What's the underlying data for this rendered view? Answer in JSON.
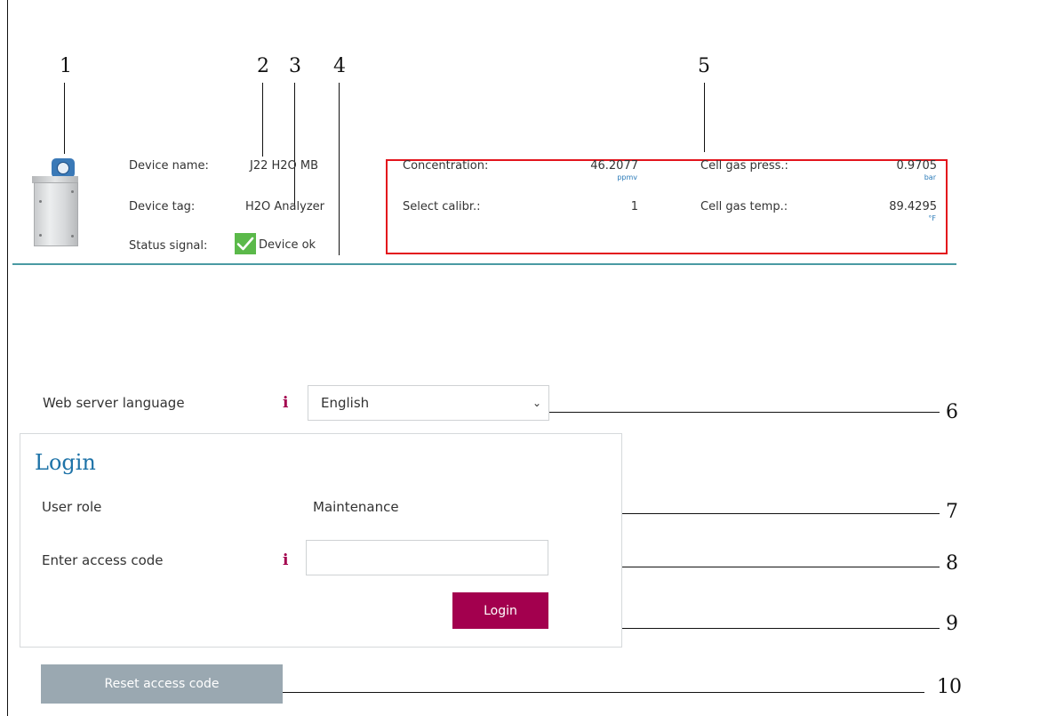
{
  "callouts": {
    "c1": "1",
    "c2": "2",
    "c3": "3",
    "c4": "4",
    "c5": "5",
    "c6": "6",
    "c7": "7",
    "c8": "8",
    "c9": "9",
    "c10": "10"
  },
  "header": {
    "device_name_label": "Device name:",
    "device_name_value": "J22 H2O MB",
    "device_tag_label": "Device tag:",
    "device_tag_value": "H2O Analyzer",
    "status_signal_label": "Status signal:",
    "status_signal_value": "Device ok",
    "device_image_icon": "analyzer-cabinet-icon",
    "status_icon": "checkmark-icon"
  },
  "measurements": {
    "concentration_label": "Concentration:",
    "concentration_value": "46.2077",
    "concentration_unit": "ppmv",
    "select_calibr_label": "Select calibr.:",
    "select_calibr_value": "1",
    "cell_gas_press_label": "Cell gas press.:",
    "cell_gas_press_value": "0.9705",
    "cell_gas_press_unit": "bar",
    "cell_gas_temp_label": "Cell gas temp.:",
    "cell_gas_temp_value": "89.4295",
    "cell_gas_temp_unit": "°F"
  },
  "language": {
    "label": "Web server language",
    "selected": "English",
    "info_icon": "i"
  },
  "login": {
    "title": "Login",
    "user_role_label": "User role",
    "user_role_value": "Maintenance",
    "access_code_label": "Enter access code",
    "access_code_value": "",
    "info_icon": "i",
    "login_button": "Login"
  },
  "reset": {
    "button": "Reset access code"
  },
  "colors": {
    "accent": "#a3004e",
    "title_blue": "#1e73a8",
    "header_rule": "#4a9aa3",
    "highlight_box": "#e3141c",
    "status_ok": "#5bb94a",
    "reset_button": "#9aa8b1"
  }
}
